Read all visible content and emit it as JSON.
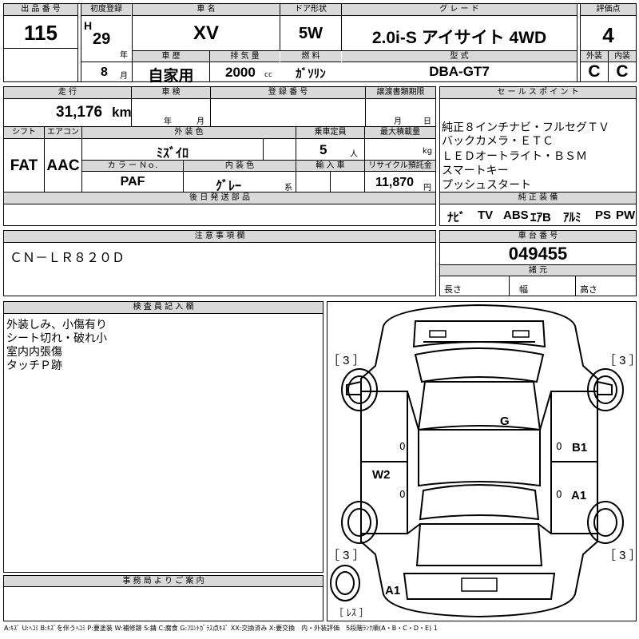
{
  "header": {
    "lot_label": "出 品 番 号",
    "lot_value": "115",
    "first_reg_label": "初度登録",
    "era": "H",
    "year": "29",
    "year_unit": "年",
    "month": "8",
    "month_unit": "月",
    "car_name_label": "車 名",
    "car_name": "XV",
    "door_label": "ドア形状",
    "door": "5W",
    "grade_label": "グ レ ー ド",
    "grade": "2.0i-S アイサイト 4WD",
    "score_label": "評価点",
    "score": "4",
    "history_label": "車 歴",
    "history": "自家用",
    "displacement_label": "排 気 量",
    "displacement": "2000",
    "displacement_unit": "cc",
    "fuel_label": "燃 料",
    "fuel": "ｶﾞｿﾘﾝ",
    "model_label": "型 式",
    "model": "DBA-GT7",
    "exterior_label": "外装",
    "exterior": "C",
    "interior_label": "内装",
    "interior": "C"
  },
  "details": {
    "mileage_label": "走 行",
    "mileage": "31,176",
    "mileage_unit": "km",
    "inspection_label": "車 検",
    "inspection_year": "年",
    "inspection_month": "月",
    "reg_no_label": "登 録 番 号",
    "transfer_label": "譲渡書類期限",
    "transfer_month": "月",
    "transfer_day": "日",
    "shift_label": "シフト",
    "shift": "FAT",
    "ac_label": "エアコン",
    "ac": "AAC",
    "color_label": "外 装 色",
    "color": "ﾐｽﾞｲﾛ",
    "capacity_label": "乗車定員",
    "capacity": "5",
    "capacity_unit": "人",
    "load_label": "最大積載量",
    "load_unit": "kg",
    "color_no_label": "カ ラ ー Ｎｏ.",
    "color_no": "PAF",
    "int_color_label": "内 装 色",
    "int_color": "ｸﾞﾚｰ",
    "int_color_unit": "系",
    "import_label": "輸 入 車",
    "recycle_label": "リサイクル預託金",
    "recycle": "11,870",
    "recycle_unit": "円",
    "later_parts_label": "後 日 発 送 部 品"
  },
  "sales_points": {
    "label": "セ ー ル ス ポ イ ン ト",
    "lines": [
      "純正８インチナビ・フルセグＴＶ",
      "バックカメラ・ＥＴＣ",
      "ＬＥＤオートライト・ＢＳＭ",
      "スマートキー",
      "プッシュスタート"
    ]
  },
  "equipment": {
    "label": "純 正 装 備",
    "items": [
      "ﾅﾋﾞ",
      "TV",
      "ABS",
      "ｴｱB",
      "ｱﾙﾐ",
      "PS",
      "PW"
    ]
  },
  "notes": {
    "label": "注 意 事 項 欄",
    "text": "ＣＮ－ＬＲ８２０Ｄ"
  },
  "chassis": {
    "label": "車 台 番 号",
    "value": "049455",
    "dims_label": "諸 元",
    "length_label": "長さ",
    "width_label": "幅",
    "height_label": "高さ"
  },
  "inspector": {
    "label": "検 査 員 記 入 欄",
    "lines": [
      "外装しみ、小傷有り",
      "シート切れ・破れ小",
      "室内内張傷",
      "タッチＰ跡"
    ]
  },
  "office": {
    "label": "事 務 局 よ り ご 案 内"
  },
  "diagram": {
    "tire_fl": "［ 3 ］",
    "tire_fr": "［ 3 ］",
    "tire_rl": "［ 3 ］",
    "tire_rr": "［ 3 ］",
    "spare": "［ ﾚｽ ］",
    "mark_g": "G",
    "mark_b1": "B1",
    "mark_w2": "W2",
    "mark_a1_side": "A1",
    "mark_a1_rear": "A1",
    "zero_l1": "0",
    "zero_l2": "0",
    "zero_r1": "0",
    "zero_r2": "0"
  },
  "legend": "A:ｷｽﾞ U:ﾍｺﾐ B:ｷｽﾞを伴うﾍｺﾐ P:要塗装 W:補修跡 S:錆 C:腐食 G:ﾌﾛﾝﾄｶﾞﾗｽ点ｷｽﾞ XX:交換済み X:要交換　内・外装評価　5段階ﾗﾝｸ順(A・B・C・D・E) 1"
}
